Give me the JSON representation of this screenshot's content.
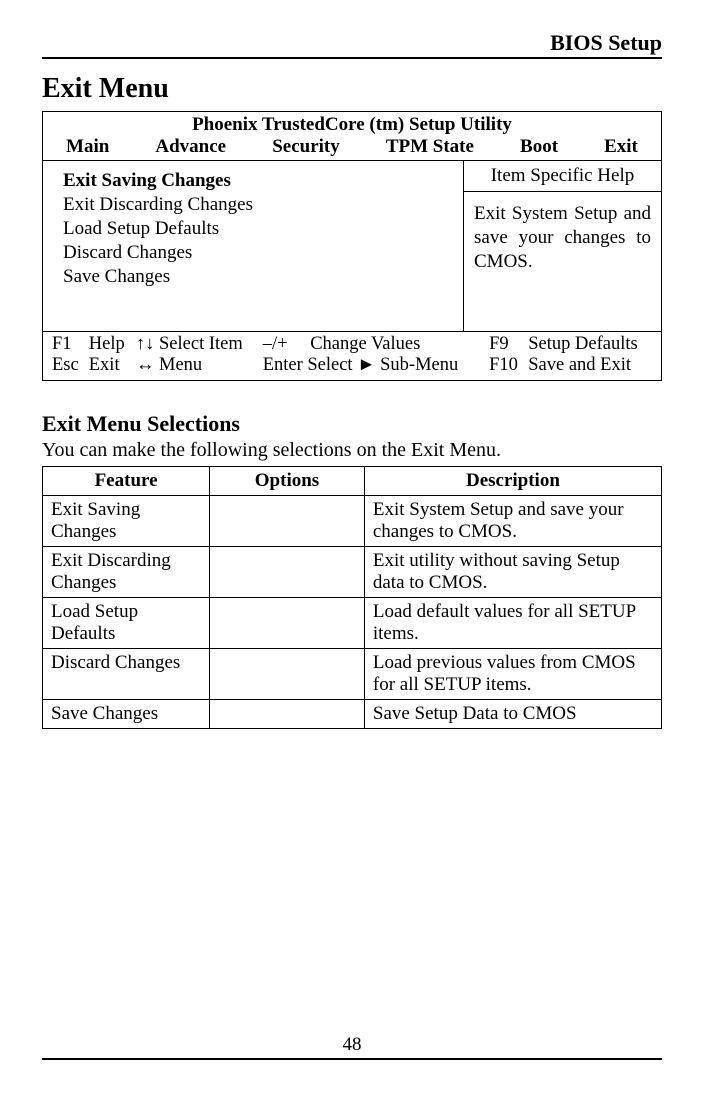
{
  "header": "BIOS Setup",
  "h1": "Exit Menu",
  "bios": {
    "title": "Phoenix TrustedCore (tm) Setup Utility",
    "tabs": [
      "Main",
      "Advance",
      "Security",
      "TPM State",
      "Boot",
      "Exit"
    ],
    "items": [
      "Exit Saving Changes",
      "Exit Discarding Changes",
      "Load Setup Defaults",
      "Discard Changes",
      "Save Changes"
    ],
    "selected_index": 0,
    "help_title": "Item Specific Help",
    "help_text": "Exit System Setup and save your changes to CMOS.",
    "keys": {
      "f1_key": "F1",
      "f1_label": "Help",
      "esc_key": "Esc",
      "esc_label": "Exit",
      "updown": "↑↓ Select Item",
      "leftright": "↔ Menu",
      "pm_key": "–/+",
      "pm_label": "Change Values",
      "enter": "Enter Select ► Sub-Menu",
      "f9_key": "F9",
      "f9_label": "Setup Defaults",
      "f10_key": "F10",
      "f10_label": "Save and Exit"
    }
  },
  "h2": "Exit Menu Selections",
  "intro": "You can make the following selections on the Exit Menu.",
  "sel_table": {
    "headers": [
      "Feature",
      "Options",
      "Description"
    ],
    "rows": [
      {
        "feature": "Exit Saving Changes",
        "options": "",
        "desc": "Exit System Setup and save your changes to CMOS."
      },
      {
        "feature": "Exit Discarding Changes",
        "options": "",
        "desc": "Exit utility without saving Setup data to CMOS."
      },
      {
        "feature": "Load Setup Defaults",
        "options": "",
        "desc": "Load default values for all SETUP items."
      },
      {
        "feature": "Discard Changes",
        "options": "",
        "desc": "Load previous values from CMOS for all SETUP items."
      },
      {
        "feature": "Save Changes",
        "options": "",
        "desc": "Save Setup Data to CMOS"
      }
    ]
  },
  "page_number": "48"
}
